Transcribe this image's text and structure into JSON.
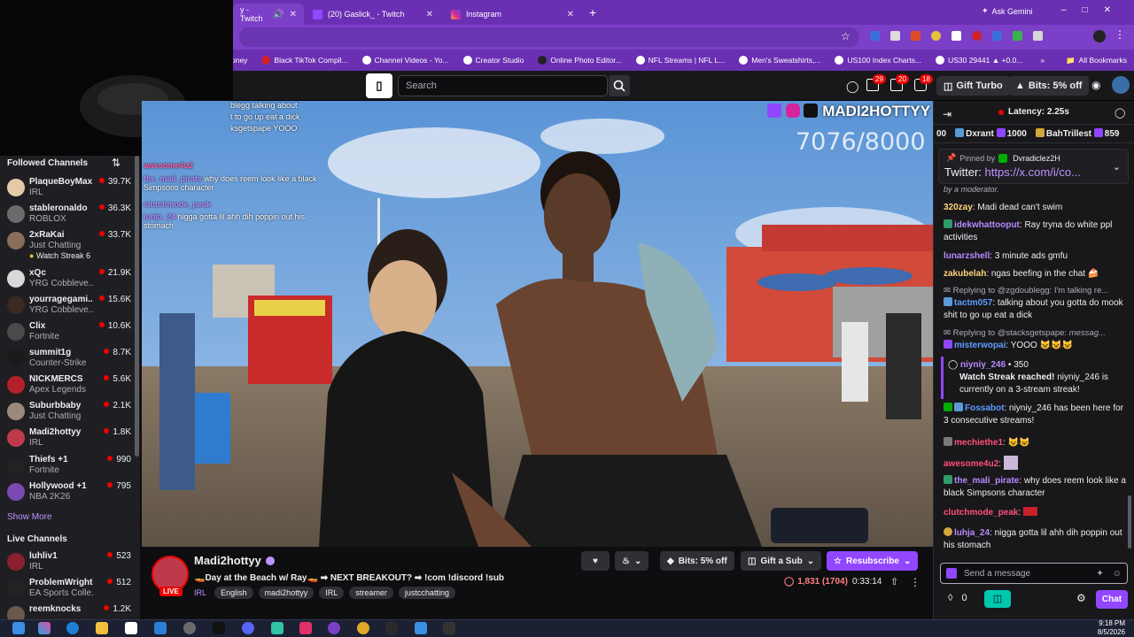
{
  "browser": {
    "tabs": [
      {
        "title": "y - Twitch",
        "active": true
      },
      {
        "title": "(20) Gaslick_ - Twitch",
        "active": false
      },
      {
        "title": "Instagram",
        "active": false
      }
    ],
    "new_tab_icon": "plus-icon",
    "ask_gemini": "Ask Gemini",
    "bookmarks": [
      "Run It Up - Rel Money",
      "Black TikTok Compil...",
      "Channel Videos - Yo...",
      "Creator Studio",
      "Online Photo Editor...",
      "NFL Streams | NFL L...",
      "Men's Sweatshirts,...",
      "US100 Index Charts...",
      "US30 29441 ▲ +0.0..."
    ],
    "all_bookmarks": "All Bookmarks"
  },
  "twitch_nav": {
    "search_placeholder": "Search",
    "notif_counts": [
      "29",
      "20",
      "18"
    ],
    "gift_turbo": "Gift Turbo",
    "bits": "Bits: 5% off"
  },
  "sidebar": {
    "followed_title": "Followed Channels",
    "followed": [
      {
        "name": "PlaqueBoyMax",
        "game": "IRL",
        "viewers": "39.7K",
        "color": "#e6c9a8"
      },
      {
        "name": "stableronaldo",
        "game": "ROBLOX",
        "viewers": "36.3K",
        "color": "#6b6b6b"
      },
      {
        "name": "2xRaKai",
        "game": "Just Chatting",
        "viewers": "33.7K",
        "color": "#8a6e5a",
        "extra": "Watch Streak 6"
      },
      {
        "name": "xQc",
        "game": "YRG Cobbleve...",
        "viewers": "21.9K",
        "color": "#d9d9d9"
      },
      {
        "name": "yourragegami...",
        "game": "YRG Cobbleve...",
        "viewers": "15.6K",
        "color": "#3a2a22"
      },
      {
        "name": "Clix",
        "game": "Fortnite",
        "viewers": "10.6K",
        "color": "#4a4a4a"
      },
      {
        "name": "summit1g",
        "game": "Counter-Strike",
        "viewers": "8.7K",
        "color": "#1a1a1a"
      },
      {
        "name": "NICKMERCS",
        "game": "Apex Legends",
        "viewers": "5.6K",
        "color": "#b3202a"
      },
      {
        "name": "Suburbbaby",
        "game": "Just Chatting",
        "viewers": "2.1K",
        "color": "#9a8a7a"
      },
      {
        "name": "Madi2hottyy",
        "game": "IRL",
        "viewers": "1.8K",
        "color": "#c0394b"
      },
      {
        "name": "Thiefs +1",
        "game": "Fortnite",
        "viewers": "990",
        "color": "#222222"
      },
      {
        "name": "Hollywood +1",
        "game": "NBA 2K26",
        "viewers": "795",
        "color": "#7a4ab0"
      }
    ],
    "show_more": "Show More",
    "live_title": "Live Channels",
    "live": [
      {
        "name": "luhliv1",
        "game": "IRL",
        "viewers": "523",
        "color": "#8a2030"
      },
      {
        "name": "ProblemWright",
        "game": "EA Sports Colle...",
        "viewers": "512",
        "color": "#222222"
      },
      {
        "name": "reemknocks",
        "game": "",
        "viewers": "1.2K",
        "color": "#6a5a4a"
      }
    ]
  },
  "video": {
    "goal_counter": "7076/8000",
    "brand_text": "MADI2HOTTYY",
    "overlay_chat": [
      {
        "user": "",
        "text": "blegg talking about"
      },
      {
        "user": "",
        "text": "t to go up eat a dick"
      },
      {
        "user": "",
        "text": "ksgetspape YOOO"
      },
      {
        "user": "awesome4u2",
        "text": ""
      },
      {
        "user": "the_mali_pirate",
        "text": "why does reem look like a black Simpsons character"
      },
      {
        "user": "clutchmode_peak",
        "text": ""
      },
      {
        "user": "luhja_24",
        "text": "nigga gotta lil ahh dih poppin out his stomach"
      }
    ]
  },
  "stream": {
    "channel": "Madi2hottyy",
    "live_label": "LIVE",
    "title": "🚤Day at the Beach w/ Ray🚤 ➡ NEXT BREAKOUT? ➡ !com !discord !sub",
    "tags": [
      "IRL",
      "English",
      "madi2hottyy",
      "IRL",
      "streamer",
      "justcchatting"
    ],
    "viewers": "1,831 (1704)",
    "uptime": "0:33:14",
    "bits_label": "Bits: 5% off",
    "gift_label": "Gift a Sub",
    "subscribe_label": "Resubscribe"
  },
  "chat": {
    "latency": "Latency: 2.25s",
    "leaderboard": [
      {
        "name": "00",
        "amount": ""
      },
      {
        "name": "Dxrant",
        "amount": "1000"
      },
      {
        "name": "BahTrillest",
        "amount": "859"
      }
    ],
    "pinned_by": "Pinned by",
    "pinned_user": "Dvradiclez2H",
    "pinned_text": "Twitter:",
    "pinned_link": "https://x.com/i/co...",
    "moderator_note": "by a moderator.",
    "messages": [
      {
        "user": "320zay",
        "color": "#ffd37a",
        "text": "Madi dead can't swim"
      },
      {
        "user": "idekwhattooput",
        "color": "#b68aff",
        "text": "Ray tryna do white ppl activities"
      },
      {
        "user": "lunarzshell",
        "color": "#b68aff",
        "text": "3 minute ads gmfu"
      },
      {
        "user": "zakubelah",
        "color": "#ffd37a",
        "text": "ngas beefing in the chat"
      },
      {
        "reply": "Replying to @zgdoublegg: I'm talking re..."
      },
      {
        "user": "tactm057",
        "color": "#5c9dff",
        "text": "talking about you gotta do mook shit to go up eat a dick"
      },
      {
        "reply": "Replying to @stacksgetspape:",
        "reply_em": "messag..."
      },
      {
        "user": "misterwopai",
        "color": "#5c9dff",
        "text": "YOOO"
      },
      {
        "user": "niyniy_246",
        "color": "#b68aff",
        "text": "350",
        "streak_title": "Watch Streak reached!",
        "streak_text": "niyniy_246 is currently on a 3-stream streak!"
      },
      {
        "user": "Fossabot",
        "color": "#5c9dff",
        "text": "niyniy_246 has been here for 3 consecutive streams!"
      },
      {
        "user": "mechiethe1",
        "color": "#ff4f7b",
        "text": ""
      },
      {
        "user": "awesome4u2",
        "color": "#ff4f7b",
        "text": ""
      },
      {
        "user": "the_mali_pirate",
        "color": "#b68aff",
        "text": "why does reem look like a black Simpsons character"
      },
      {
        "user": "clutchmode_peak",
        "color": "#ff4f7b",
        "text": ""
      },
      {
        "user": "luhja_24",
        "color": "#b68aff",
        "text": "nigga gotta lil ahh dih poppin out his stomach"
      }
    ],
    "input_placeholder": "Send a message",
    "points": "0",
    "chat_button": "Chat"
  },
  "taskbar": {
    "time": "9:18 PM",
    "date": "8/5/2026"
  }
}
